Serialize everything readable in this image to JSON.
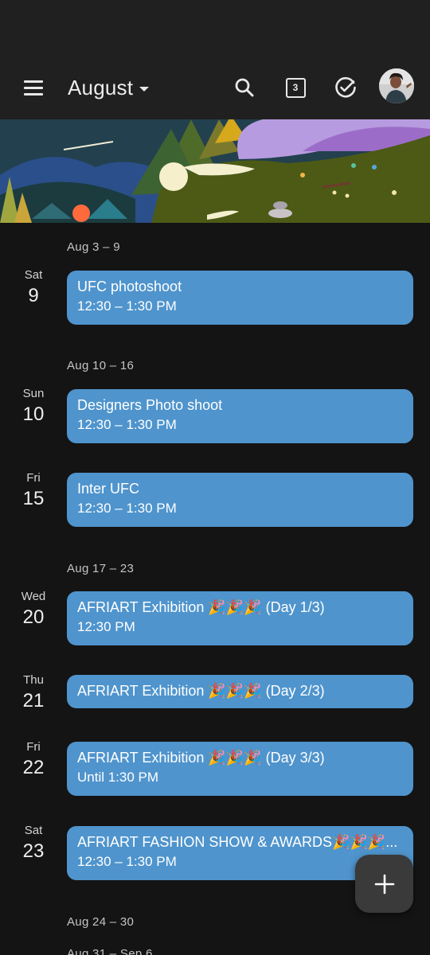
{
  "header": {
    "month": "August",
    "today_day": "3",
    "icons": [
      "menu-icon",
      "caret-down-icon",
      "search-icon",
      "calendar-today-icon",
      "tasks-check-icon",
      "avatar"
    ]
  },
  "weeks": [
    {
      "label": "Aug 3 – 9"
    },
    {
      "label": "Aug 10 – 16"
    },
    {
      "label": "Aug 17 – 23"
    },
    {
      "label": "Aug 24 – 30"
    },
    {
      "label": "Aug 31 – Sep 6"
    }
  ],
  "days": [
    {
      "name": "Sat",
      "num": "9",
      "event": {
        "title": "UFC photoshoot",
        "time": "12:30 – 1:30 PM"
      }
    },
    {
      "name": "Sun",
      "num": "10",
      "event": {
        "title": "Designers Photo shoot",
        "time": "12:30 – 1:30 PM"
      }
    },
    {
      "name": "Fri",
      "num": "15",
      "event": {
        "title": "Inter UFC",
        "time": "12:30 – 1:30 PM"
      }
    },
    {
      "name": "Wed",
      "num": "20",
      "event": {
        "title": "AFRIART Exhibition 🎉🎉🎉 (Day 1/3)",
        "time": "12:30 PM"
      }
    },
    {
      "name": "Thu",
      "num": "21",
      "event": {
        "title": "AFRIART Exhibition 🎉🎉🎉 (Day 2/3)",
        "time": ""
      }
    },
    {
      "name": "Fri",
      "num": "22",
      "event": {
        "title": "AFRIART Exhibition 🎉🎉🎉 (Day 3/3)",
        "time": "Until 1:30 PM"
      }
    },
    {
      "name": "Sat",
      "num": "23",
      "event": {
        "title": "AFRIART FASHION SHOW & AWARDS🎉🎉🎉...",
        "time": "12:30 – 1:30 PM"
      }
    }
  ],
  "colors": {
    "background": "#141414",
    "app_bar": "#202020",
    "event": "#4f94cd",
    "fab": "#3a3a3a"
  },
  "fab": {
    "icon": "plus-icon"
  }
}
